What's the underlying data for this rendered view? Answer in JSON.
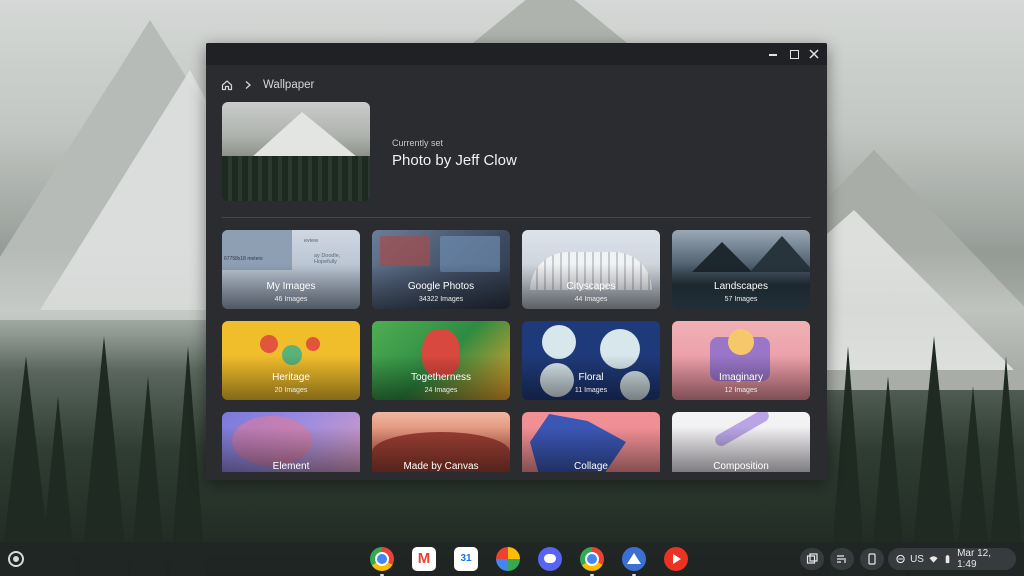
{
  "window": {
    "breadcrumb": {
      "home_icon": "home-icon",
      "section": "Wallpaper"
    },
    "current": {
      "label": "Currently set",
      "title": "Photo by Jeff Clow"
    },
    "collections": [
      {
        "name": "My Images",
        "count": "46 Images",
        "overlay_lines": [
          "67758x18 meters",
          "eview",
          "ay Doodle, Hopefully"
        ]
      },
      {
        "name": "Google Photos",
        "count": "34322 Images"
      },
      {
        "name": "Cityscapes",
        "count": "44 Images"
      },
      {
        "name": "Landscapes",
        "count": "57 Images"
      },
      {
        "name": "Heritage",
        "count": "20 Images"
      },
      {
        "name": "Togetherness",
        "count": "24 Images"
      },
      {
        "name": "Floral",
        "count": "11 Images"
      },
      {
        "name": "Imaginary",
        "count": "12 Images"
      },
      {
        "name": "Element",
        "count": ""
      },
      {
        "name": "Made by Canvas",
        "count": ""
      },
      {
        "name": "Collage",
        "count": ""
      },
      {
        "name": "Composition",
        "count": ""
      }
    ]
  },
  "shelf": {
    "apps": [
      "chrome",
      "gmail",
      "calendar",
      "photos",
      "discord",
      "chrome",
      "wallpaper",
      "youtube"
    ],
    "status": {
      "keyboard": "US",
      "date_time": "Mar 12, 1:49"
    }
  }
}
